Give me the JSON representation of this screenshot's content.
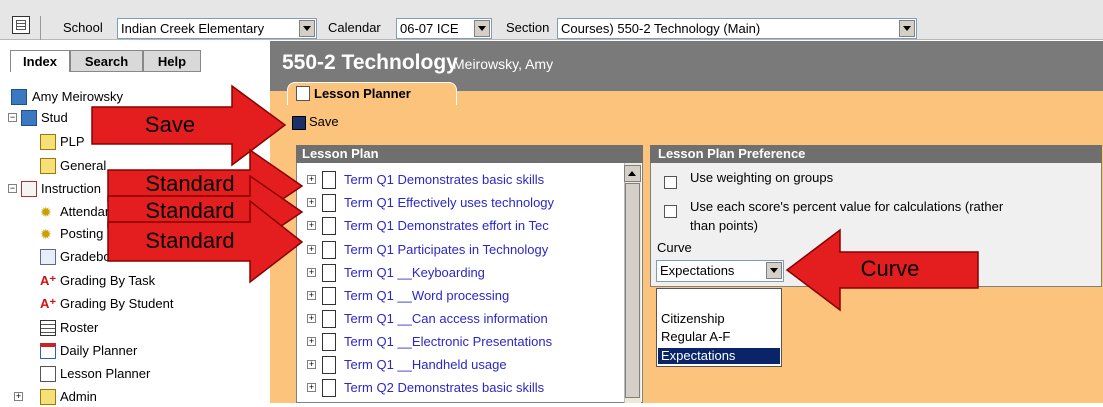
{
  "toolbar": {
    "school_label": "School",
    "school_value": "Indian Creek Elementary",
    "calendar_label": "Calendar",
    "calendar_value": "06-07 ICE",
    "section_label": "Section",
    "section_value": "Courses) 550-2 Technology (Main)"
  },
  "left_tabs": [
    "Index",
    "Search",
    "Help"
  ],
  "tree": {
    "user": "Amy Meirowsky",
    "student_prefix": "Stud",
    "items": [
      {
        "label": "PLP"
      },
      {
        "label": "General"
      },
      {
        "label": "Instruction"
      },
      {
        "label": "Attendance"
      },
      {
        "label": "Posting"
      },
      {
        "label": "Gradebook"
      },
      {
        "label": "Grading By Task"
      },
      {
        "label": "Grading By Student"
      },
      {
        "label": "Roster"
      },
      {
        "label": "Daily Planner"
      },
      {
        "label": "Lesson Planner"
      },
      {
        "label": "Admin"
      }
    ]
  },
  "header": {
    "section_title": "550-2 Technology",
    "teacher": "Meirowsky, Amy",
    "tab_label": "Lesson Planner"
  },
  "save_label": "Save",
  "lesson_plan": {
    "title": "Lesson Plan",
    "rows": [
      "Term Q1 Demonstrates basic skills",
      "Term Q1 Effectively uses technology",
      "Term Q1 Demonstrates effort in Tec",
      "Term Q1 Participates in Technology",
      "Term Q1 __Keyboarding",
      "Term Q1 __Word processing",
      "Term Q1 __Can access information",
      "Term Q1 __Electronic Presentations",
      "Term Q1 __Handheld usage",
      "Term Q2 Demonstrates basic skills"
    ]
  },
  "preference": {
    "title": "Lesson Plan Preference",
    "option1": "Use weighting on groups",
    "option2_line1": "Use each score's percent value for calculations (rather",
    "option2_line2": "than points)",
    "curve_label": "Curve",
    "curve_value": "Expectations",
    "curve_options": [
      "",
      "Citizenship",
      "Regular A-F",
      "Expectations"
    ]
  },
  "callouts": {
    "save": "Save",
    "standard": "Standard",
    "curve": "Curve"
  },
  "colors": {
    "arrow_red": "#e41e1e",
    "panel_orange": "#fbc37c",
    "link_blue": "#2b27c8"
  }
}
